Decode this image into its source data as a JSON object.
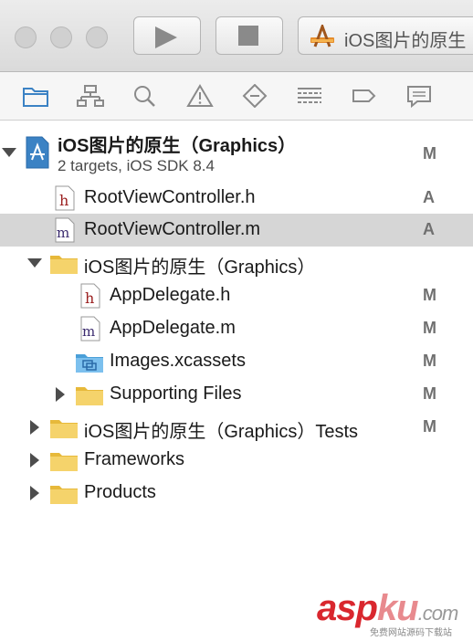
{
  "toolbar": {
    "window_controls": [
      "close",
      "minimize",
      "zoom"
    ],
    "run_icon": "play-icon",
    "stop_icon": "stop-icon",
    "scheme_label": "iOS图片的原生"
  },
  "navigator": {
    "icons": [
      "folder-icon",
      "hierarchy-icon",
      "search-icon",
      "warning-icon",
      "test-diamond-icon",
      "debug-list-icon",
      "breakpoint-icon",
      "report-icon"
    ],
    "selected": "folder-icon"
  },
  "project": {
    "title": "iOS图片的原生（Graphics）",
    "subtitle": "2 targets, iOS SDK 8.4",
    "badge": "M"
  },
  "tree": [
    {
      "label": "RootViewController.h",
      "kind": "h-file",
      "badge": "A",
      "selected": false
    },
    {
      "label": "RootViewController.m",
      "kind": "m-file",
      "badge": "A",
      "selected": true
    },
    {
      "label": "iOS图片的原生（Graphics）",
      "kind": "folder",
      "expanded": true,
      "badge": ""
    },
    {
      "label": "AppDelegate.h",
      "kind": "h-file",
      "badge": "M"
    },
    {
      "label": "AppDelegate.m",
      "kind": "m-file",
      "badge": "M"
    },
    {
      "label": "Images.xcassets",
      "kind": "assets-folder",
      "badge": "M"
    },
    {
      "label": "Supporting Files",
      "kind": "folder",
      "expanded": false,
      "badge": "M"
    },
    {
      "label": "iOS图片的原生（Graphics）Tests",
      "kind": "folder",
      "expanded": false,
      "badge": "M"
    },
    {
      "label": "Frameworks",
      "kind": "folder",
      "expanded": false,
      "badge": ""
    },
    {
      "label": "Products",
      "kind": "folder",
      "expanded": false,
      "badge": ""
    }
  ],
  "watermark": {
    "brand_a": "asp",
    "brand_b": "ku",
    "brand_c": ".com",
    "tagline": "免费网站源码下载站"
  },
  "colors": {
    "selection": "#d6d6d6",
    "folder": "#f2c94c",
    "accent": "#3b82c4",
    "h_letter": "#9b2020",
    "m_letter": "#3a2a6e"
  }
}
